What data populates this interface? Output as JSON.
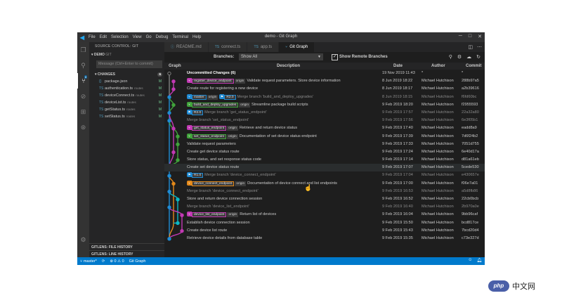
{
  "window": {
    "title": "demo - Git Graph",
    "menu": [
      "File",
      "Edit",
      "Selection",
      "View",
      "Go",
      "Debug",
      "Terminal",
      "Help"
    ]
  },
  "activity_icons": [
    "files-icon",
    "search-icon",
    "source-control-icon",
    "debug-icon",
    "extensions-icon",
    "git-graph-icon",
    "settings-gear-icon"
  ],
  "sidebar": {
    "title": "SOURCE CONTROL: GIT",
    "section": "DEMO",
    "section_suffix": "GIT",
    "message_placeholder": "Message (Ctrl+Enter to commit)",
    "changes_label": "CHANGES",
    "changes_count": "6",
    "files": [
      {
        "name": "package.json",
        "dir": "",
        "status": "M"
      },
      {
        "name": "authentication.ts",
        "dir": "routes",
        "status": "M"
      },
      {
        "name": "deviceConnect.ts",
        "dir": "routes",
        "status": "M"
      },
      {
        "name": "deviceList.ts",
        "dir": "routes",
        "status": "M"
      },
      {
        "name": "getStatus.ts",
        "dir": "routes",
        "status": "M"
      },
      {
        "name": "setStatus.ts",
        "dir": "routes",
        "status": "M"
      }
    ],
    "bottom_sections": [
      "GITLENS: FILE HISTORY",
      "GITLENS: LINE HISTORY"
    ]
  },
  "tabs": [
    {
      "label": "README.md",
      "active": false
    },
    {
      "label": "connect.ts",
      "active": false
    },
    {
      "label": "app.ts",
      "active": false
    },
    {
      "label": "Git Graph",
      "active": true
    }
  ],
  "controls": {
    "branches_label": "Branches:",
    "branches_value": "Show All",
    "show_remote_label": "Show Remote Branches",
    "show_remote_checked": true
  },
  "columns": [
    "Graph",
    "Description",
    "Date",
    "Author",
    "Commit"
  ],
  "commits": [
    {
      "refs": [],
      "desc": "Uncommitted Changes (6)",
      "date": "19 Nov 2019 11:43",
      "author": "*",
      "commit": "*",
      "bold": true
    },
    {
      "refs": [
        {
          "name": "register_device_endpoint",
          "origin": "origin",
          "color": "#c239b3"
        }
      ],
      "desc": "Validate request parameters. Store device information",
      "date": "8 Jun 2019 18:22",
      "author": "Michael Hutchison",
      "commit": "288b97a5"
    },
    {
      "refs": [],
      "desc": "Create route for registering a new device",
      "date": "8 Jun 2019 18:17",
      "author": "Michael Hutchison",
      "commit": "a2b39616"
    },
    {
      "refs": [
        {
          "name": "master",
          "origin": "origin",
          "color": "#1f8ad3"
        },
        {
          "name": "R2.0",
          "origin": "",
          "color": "#1f8ad3"
        }
      ],
      "desc": "Merge branch 'build_and_deploy_upgrades'",
      "date": "8 Jun 2019 18:15",
      "author": "Michael Hutchison",
      "commit": "f6fd60bc",
      "dim": true
    },
    {
      "refs": [
        {
          "name": "build_and_deploy_upgrades",
          "origin": "origin",
          "color": "#40a33b"
        }
      ],
      "desc": "Streamline package build scripts",
      "date": "9 Feb 2019 18:20",
      "author": "Michael Hutchison",
      "commit": "f2955593"
    },
    {
      "refs": [
        {
          "name": "R2.0",
          "origin": "",
          "color": "#1f8ad3"
        }
      ],
      "desc": "Merge branch 'get_status_endpoint'",
      "date": "9 Feb 2019 17:57",
      "author": "Michael Hutchison",
      "commit": "22a32a80",
      "dim": true
    },
    {
      "refs": [],
      "desc": "Merge branch 'set_status_endpoint'",
      "date": "9 Feb 2019 17:56",
      "author": "Michael Hutchison",
      "commit": "6e3f05b1",
      "dim": true
    },
    {
      "refs": [
        {
          "name": "get_status_endpoint",
          "origin": "origin",
          "color": "#c239b3"
        }
      ],
      "desc": "Retrieve and return device status",
      "date": "9 Feb 2019 17:40",
      "author": "Michael Hutchison",
      "commit": "eadd8a9"
    },
    {
      "refs": [
        {
          "name": "set_status_endpoint",
          "origin": "origin",
          "color": "#40a33b"
        }
      ],
      "desc": "Documentation of set device status endpoint",
      "date": "9 Feb 2019 17:39",
      "author": "Michael Hutchison",
      "commit": "7d6f24b2"
    },
    {
      "refs": [],
      "desc": "Validate request parameters",
      "date": "9 Feb 2019 17:33",
      "author": "Michael Hutchison",
      "commit": "7051d755"
    },
    {
      "refs": [],
      "desc": "Create get device status route",
      "date": "9 Feb 2019 17:24",
      "author": "Michael Hutchison",
      "commit": "6e40d17a"
    },
    {
      "refs": [],
      "desc": "Store status, and set response status code",
      "date": "9 Feb 2019 17:14",
      "author": "Michael Hutchison",
      "commit": "d81a61eb"
    },
    {
      "refs": [],
      "desc": "Create set device status route",
      "date": "9 Feb 2019 17:07",
      "author": "Michael Hutchison",
      "commit": "5cede530",
      "hl": true
    },
    {
      "refs": [
        {
          "name": "R1.0",
          "origin": "",
          "color": "#1f8ad3"
        }
      ],
      "desc": "Merge branch 'device_connect_endpoint'",
      "date": "9 Feb 2019 17:04",
      "author": "Michael Hutchison",
      "commit": "e430657e",
      "dim": true
    },
    {
      "refs": [
        {
          "name": "device_connect_endpoint",
          "origin": "origin",
          "color": "#e4891a"
        }
      ],
      "desc": "Documentation of device connect and list endpoints",
      "date": "9 Feb 2019 17:00",
      "author": "Michael Hutchison",
      "commit": "f06e7a01"
    },
    {
      "refs": [],
      "desc": "Merge branch 'device_connect_endpoint'",
      "date": "9 Feb 2019 16:53",
      "author": "Michael Hutchison",
      "commit": "a5d8fb86",
      "dim": true
    },
    {
      "refs": [],
      "desc": "Store and return device connection session",
      "date": "9 Feb 2019 16:52",
      "author": "Michael Hutchison",
      "commit": "22cb0bcb"
    },
    {
      "refs": [],
      "desc": "Merge branch 'device_list_endpoint'",
      "date": "9 Feb 2019 16:40",
      "author": "Michael Hutchison",
      "commit": "2b970a0e",
      "dim": true
    },
    {
      "refs": [
        {
          "name": "device_list_endpoint",
          "origin": "origin",
          "color": "#c239b3"
        }
      ],
      "desc": "Return list of devices",
      "date": "9 Feb 2019 16:04",
      "author": "Michael Hutchison",
      "commit": "9bb96caf"
    },
    {
      "refs": [],
      "desc": "Establish device connection session",
      "date": "9 Feb 2019 15:50",
      "author": "Michael Hutchison",
      "commit": "bcd817ce"
    },
    {
      "refs": [],
      "desc": "Create device list route",
      "date": "9 Feb 2019 15:43",
      "author": "Michael Hutchison",
      "commit": "7bcd20d4"
    },
    {
      "refs": [],
      "desc": "Retrieve device details from database table",
      "date": "9 Feb 2019 15:35",
      "author": "Michael Hutchison",
      "commit": "c73e327d"
    }
  ],
  "statusbar": {
    "branch": "master*",
    "problems": "⊗ 0 ⚠ 0",
    "git_graph": "Git Graph"
  },
  "watermark": {
    "logo": "php",
    "text": "中文网"
  },
  "colors": {
    "accent": "#007acc",
    "blue": "#1f8ad3",
    "magenta": "#c239b3",
    "green": "#40a33b",
    "orange": "#e4891a",
    "cyan": "#0ab8c4",
    "gray": "#808080"
  }
}
